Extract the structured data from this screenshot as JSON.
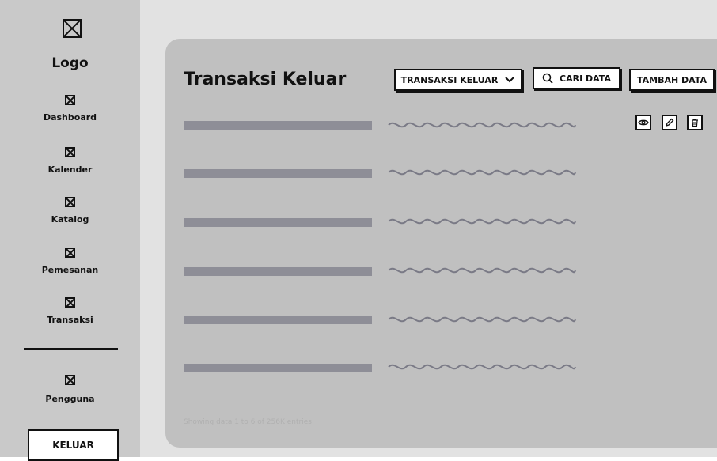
{
  "sidebar": {
    "logo_text": "Logo",
    "items": [
      {
        "label": "Dashboard"
      },
      {
        "label": "Kalender"
      },
      {
        "label": "Katalog"
      },
      {
        "label": "Pemesanan"
      },
      {
        "label": "Transaksi"
      },
      {
        "label": "Pengguna"
      }
    ],
    "logout_label": "KELUAR"
  },
  "main": {
    "title": "Transaksi Keluar",
    "filter_label": "TRANSAKSI KELUAR",
    "search_label": "CARI DATA",
    "add_label": "TAMBAH DATA",
    "footer_text": "Showing data 1 to 6 of  256K entries"
  },
  "rows": [
    {},
    {},
    {},
    {},
    {},
    {}
  ],
  "icons": {
    "logo": "logo-placeholder-icon",
    "nav": "placeholder-icon",
    "filter": "chevron-down-icon",
    "search": "search-icon",
    "actions": [
      "eye-icon",
      "pencil-icon",
      "trash-icon"
    ]
  },
  "colors": {
    "sidebar_bg": "#c9c9c9",
    "panel_bg": "#c0c0c0",
    "row_bar": "#8e8e97"
  }
}
